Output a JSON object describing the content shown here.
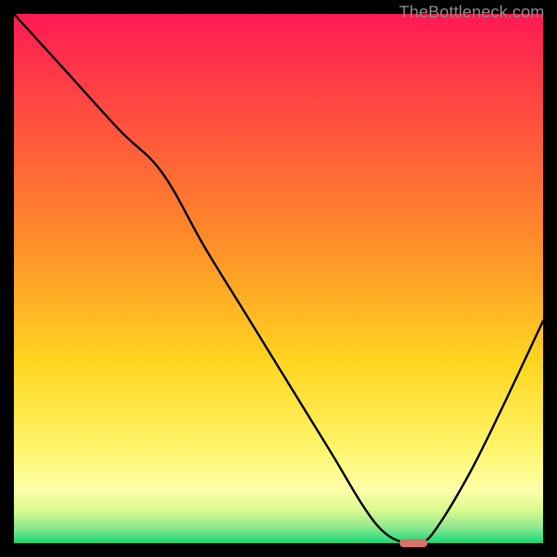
{
  "watermark": {
    "text": "TheBottleneck.com"
  },
  "chart_data": {
    "type": "line",
    "title": "",
    "xlabel": "",
    "ylabel": "",
    "xlim": [
      0,
      100
    ],
    "ylim": [
      0,
      100
    ],
    "legend": false,
    "grid": false,
    "annotations": [],
    "background_gradient": {
      "orientation": "vertical",
      "stops": [
        {
          "pos": 0.0,
          "color": "#ff1a53"
        },
        {
          "pos": 0.42,
          "color": "#ff8a2a"
        },
        {
          "pos": 0.66,
          "color": "#ffd620"
        },
        {
          "pos": 0.82,
          "color": "#fff56a"
        },
        {
          "pos": 0.9,
          "color": "#fdffa8"
        },
        {
          "pos": 0.94,
          "color": "#d6f98e"
        },
        {
          "pos": 0.97,
          "color": "#8ee88f"
        },
        {
          "pos": 1.0,
          "color": "#17d877"
        }
      ]
    },
    "series": [
      {
        "name": "bottleneck-curve",
        "color": "#000000",
        "x": [
          0,
          10,
          20,
          28,
          36,
          44,
          52,
          60,
          66,
          70,
          74,
          77,
          80,
          86,
          92,
          100
        ],
        "y": [
          100,
          89,
          78,
          70,
          56,
          43,
          30,
          17,
          7,
          2,
          0,
          0,
          3,
          13,
          25,
          42
        ]
      }
    ],
    "marker": {
      "name": "optimal-point",
      "x": 75.5,
      "y": 0,
      "width_pct": 5.2,
      "height_pct": 1.6,
      "color": "#d9726b"
    }
  }
}
